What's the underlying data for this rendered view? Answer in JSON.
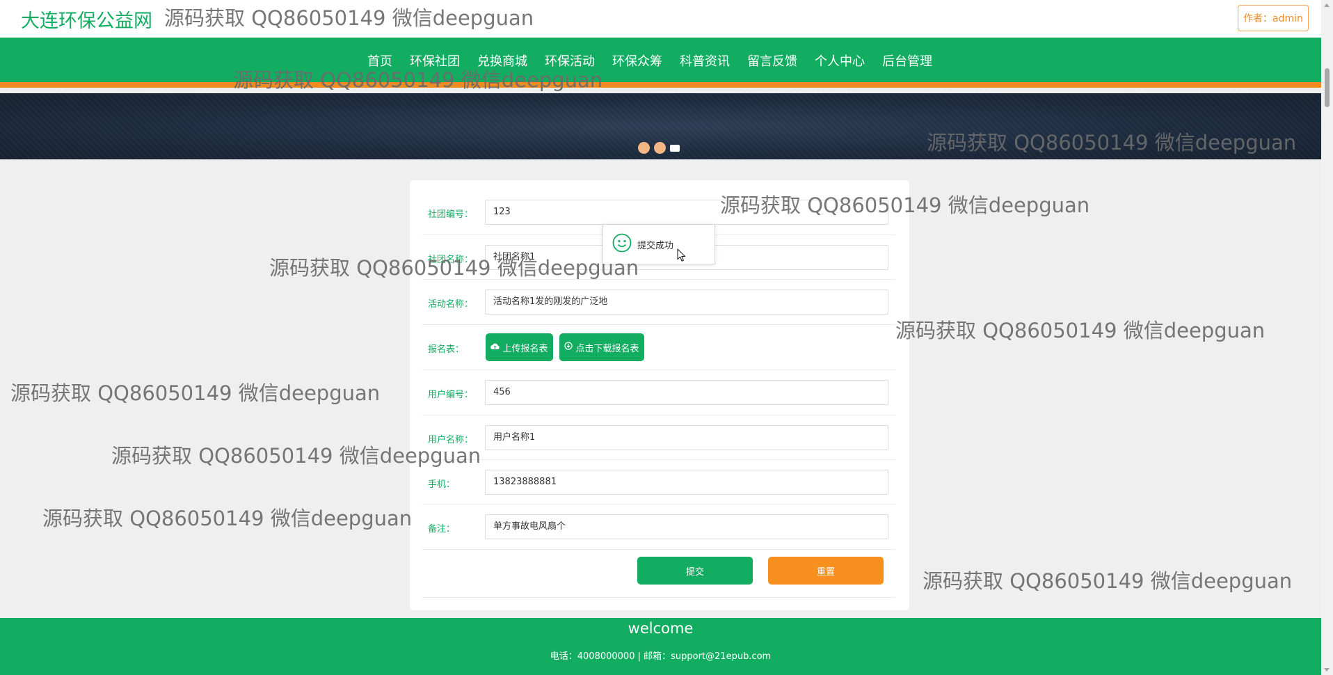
{
  "header": {
    "site_title": "大连环保公益网",
    "author_button": "作者：admin"
  },
  "nav": {
    "items": [
      "首页",
      "环保社团",
      "兑换商城",
      "环保活动",
      "环保众筹",
      "科普资讯",
      "留言反馈",
      "个人中心",
      "后台管理"
    ]
  },
  "banner": {
    "slide_count": 3,
    "active_slide": 3
  },
  "form": {
    "club_id": {
      "label": "社团编号：",
      "value": "123"
    },
    "club_name": {
      "label": "社团名称：",
      "value": "社团名称1"
    },
    "activity_name": {
      "label": "活动名称：",
      "value": "活动名称1发的刚发的广泛地"
    },
    "signup_sheet": {
      "label": "报名表：",
      "upload_label": "上传报名表",
      "download_label": "点击下载报名表"
    },
    "user_id": {
      "label": "用户编号：",
      "value": "456"
    },
    "user_name": {
      "label": "用户名称：",
      "value": "用户名称1"
    },
    "phone": {
      "label": "手机：",
      "value": "13823888881"
    },
    "remark": {
      "label": "备注：",
      "value": "单方事故电风扇个"
    },
    "submit_label": "提交",
    "reset_label": "重置"
  },
  "toast": {
    "message": "提交成功"
  },
  "footer": {
    "welcome": "welcome",
    "contact": "电话：4008000000 | 邮箱：support@21epub.com"
  },
  "watermark": {
    "text": "源码获取 QQ86050149 微信deepguan"
  },
  "colors": {
    "primary_green": "#13ad62",
    "accent_orange": "#f08b20",
    "banner_dark": "#1d2b3f"
  }
}
